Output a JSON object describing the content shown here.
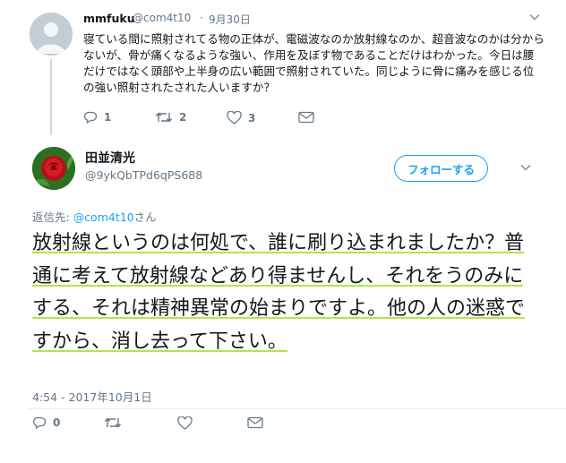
{
  "parent_tweet": {
    "name": "mmfuku",
    "handle": "@com4t10",
    "separator": "·",
    "date": "9月30日",
    "text": "寝ている間に照射されてる物の正体が、電磁波なのか放射線なのか、超音波なのかは分からないが、骨が痛くなるような強い、作用を及ぼす物であることだけはわかった。今日は腰だけではなく頭部や上半身の広い範囲で照射されていた。同じように骨に痛みを感じる位の強い照射されたされた人いますか？",
    "reply_count": "1",
    "retweet_count": "2",
    "like_count": "3"
  },
  "main_tweet": {
    "name": "田並清光",
    "handle": "@9ykQbTPd6qPS688",
    "follow_label": "フォローする",
    "reply_prefix": "返信先: ",
    "reply_mention": "@com4t10",
    "reply_suffix": "さん",
    "text": "放射線というのは何処で、誰に刷り込まれましたか？普通に考えて放射線などあり得ませんし、それをうのみにする、それは精神異常の始まりですよ。他の人の迷惑ですから、消し去って下さい。",
    "timestamp": "4:54 - 2017年10月1日",
    "reply_count": "0"
  },
  "colors": {
    "accent": "#1da1f2",
    "highlight": "#b7e34a",
    "muted": "#657786"
  },
  "icons": [
    "default-avatar-icon",
    "rose-avatar-icon",
    "chevron-down-icon",
    "reply-icon",
    "retweet-icon",
    "like-icon",
    "dm-icon"
  ]
}
